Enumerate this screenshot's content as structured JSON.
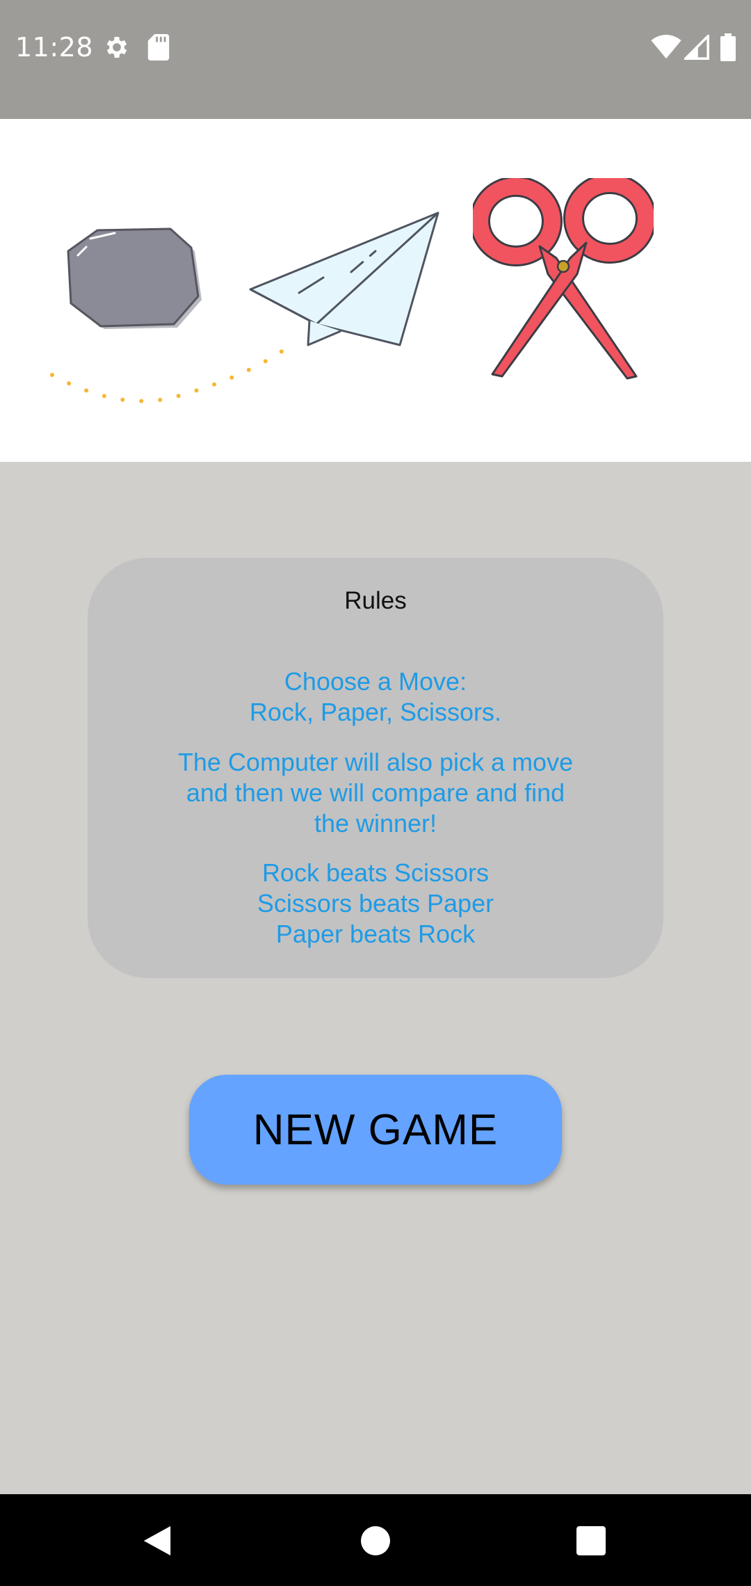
{
  "status_bar": {
    "time": "11:28",
    "icons": [
      "gear-icon",
      "sd-card-icon",
      "wifi-icon",
      "signal-icon",
      "battery-icon"
    ]
  },
  "hero": {
    "icons": [
      "rock-icon",
      "paper-airplane-icon",
      "scissors-icon"
    ]
  },
  "rules": {
    "title": "Rules",
    "block1": "Choose a Move:\nRock, Paper, Scissors.",
    "block2": "The Computer will also pick a move\nand then we will compare and find\nthe winner!",
    "block3": "Rock beats Scissors\nScissors beats Paper\nPaper beats Rock"
  },
  "actions": {
    "new_game_label": "NEW GAME"
  },
  "colors": {
    "status_bar": "#9d9c98",
    "background": "#d0cfcb",
    "card": "#c2c2c2",
    "rules_text": "#1e9be6",
    "button": "#64a3ff",
    "scissors": "#f2545f"
  },
  "nav_bar": {
    "icons": [
      "back-icon",
      "home-icon",
      "recents-icon"
    ]
  }
}
